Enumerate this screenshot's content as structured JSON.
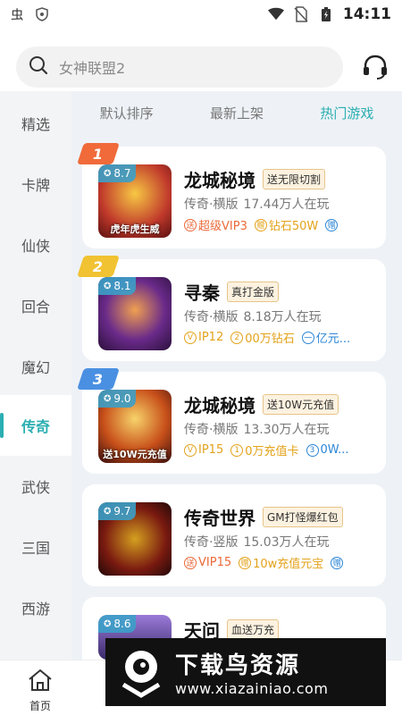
{
  "status_bar": {
    "time": "14:11"
  },
  "search": {
    "placeholder": "女神联盟2"
  },
  "sidebar": {
    "items": [
      {
        "label": "精选"
      },
      {
        "label": "卡牌"
      },
      {
        "label": "仙侠"
      },
      {
        "label": "回合"
      },
      {
        "label": "魔幻"
      },
      {
        "label": "传奇",
        "active": true
      },
      {
        "label": "武侠"
      },
      {
        "label": "三国"
      },
      {
        "label": "西游"
      }
    ]
  },
  "tabs": [
    {
      "label": "默认排序"
    },
    {
      "label": "最新上架"
    },
    {
      "label": "热门游戏",
      "active": true
    }
  ],
  "games": [
    {
      "rank": "1",
      "rank_color": "#f06a3a",
      "score": "8.7",
      "title": "龙城秘境",
      "tag": "送无限切割",
      "genre": "传奇·横版",
      "players": "17.44万人在玩",
      "icon_caption": "虎年虎生威",
      "perks": [
        {
          "icon": "送",
          "text": "超级VIP3",
          "style": "red"
        },
        {
          "icon": "赠",
          "text": "钻石50W",
          "style": "gold"
        },
        {
          "icon": "赠",
          "text": "",
          "style": "blue"
        }
      ]
    },
    {
      "rank": "2",
      "rank_color": "#f1c232",
      "score": "8.1",
      "title": "寻秦",
      "tag": "真打金版",
      "genre": "传奇·横版",
      "players": "8.18万人在玩",
      "icon_caption": "",
      "perks": [
        {
          "icon": "V",
          "text": "IP12",
          "style": "gold"
        },
        {
          "icon": "2",
          "text": "00万钻石",
          "style": "gold"
        },
        {
          "icon": "一",
          "text": "亿元...",
          "style": "blue"
        }
      ]
    },
    {
      "rank": "3",
      "rank_color": "#4a90e2",
      "score": "9.0",
      "title": "龙城秘境",
      "tag": "送10W元充值",
      "genre": "传奇·横版",
      "players": "13.30万人在玩",
      "icon_caption": "送10W元充值",
      "perks": [
        {
          "icon": "V",
          "text": "IP15",
          "style": "gold"
        },
        {
          "icon": "1",
          "text": "0万充值卡",
          "style": "gold"
        },
        {
          "icon": "3",
          "text": "0W...",
          "style": "blue"
        }
      ]
    },
    {
      "rank": "",
      "rank_color": "",
      "score": "9.7",
      "title": "传奇世界",
      "tag": "GM打怪爆红包",
      "genre": "传奇·竖版",
      "players": "15.03万人在玩",
      "icon_caption": "",
      "perks": [
        {
          "icon": "送",
          "text": "VIP15",
          "style": "red"
        },
        {
          "icon": "赠",
          "text": "10w充值元宝",
          "style": "gold"
        },
        {
          "icon": "赠",
          "text": "",
          "style": "blue"
        }
      ]
    },
    {
      "rank": "",
      "rank_color": "",
      "score": "8.6",
      "title": "天问",
      "tag": "血送万充",
      "genre": "",
      "players": "",
      "icon_caption": "",
      "perks": []
    }
  ],
  "bottom_nav": {
    "home_label": "首页"
  },
  "watermark": {
    "title": "下载鸟资源",
    "url": "www.xiazainiao.com"
  }
}
